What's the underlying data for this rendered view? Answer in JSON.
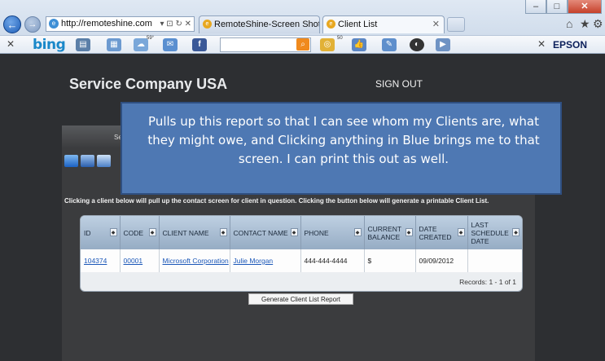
{
  "browser": {
    "address": "http://remoteshine.com",
    "tabs": [
      {
        "label": "RemoteShine-Screen Shots",
        "active": false
      },
      {
        "label": "Client List",
        "active": true
      }
    ],
    "toolbar": {
      "brand": "bing",
      "weather_temp": "59°",
      "badge_count": "50",
      "printer_brand": "EPSON"
    }
  },
  "page": {
    "company_name": "Service Company USA",
    "sign_out": "SIGN OUT",
    "panel_title_peek": "Se",
    "instruction": "Clicking a client below will pull up the contact screen for client in question. Clicking the button below will generate a printable Client List.",
    "table": {
      "columns": [
        "ID",
        "CODE",
        "CLIENT NAME",
        "CONTACT NAME",
        "PHONE",
        "CURRENT BALANCE",
        "DATE CREATED",
        "LAST SCHEDULE DATE"
      ],
      "rows": [
        {
          "id": "104374",
          "code": "00001",
          "client_name": "Microsoft Corporation",
          "contact_name": "Julie Morgan",
          "phone": "444-444-4444",
          "balance": "$",
          "date_created": "09/09/2012",
          "last_schedule": ""
        }
      ],
      "records": "Records: 1 - 1 of 1"
    },
    "generate_button": "Generate Client List Report"
  },
  "callout": {
    "text": "Pulls up this report so that I can see whom my Clients are, what they might owe, and Clicking anything in Blue brings me to that screen. I can print this out as well."
  }
}
